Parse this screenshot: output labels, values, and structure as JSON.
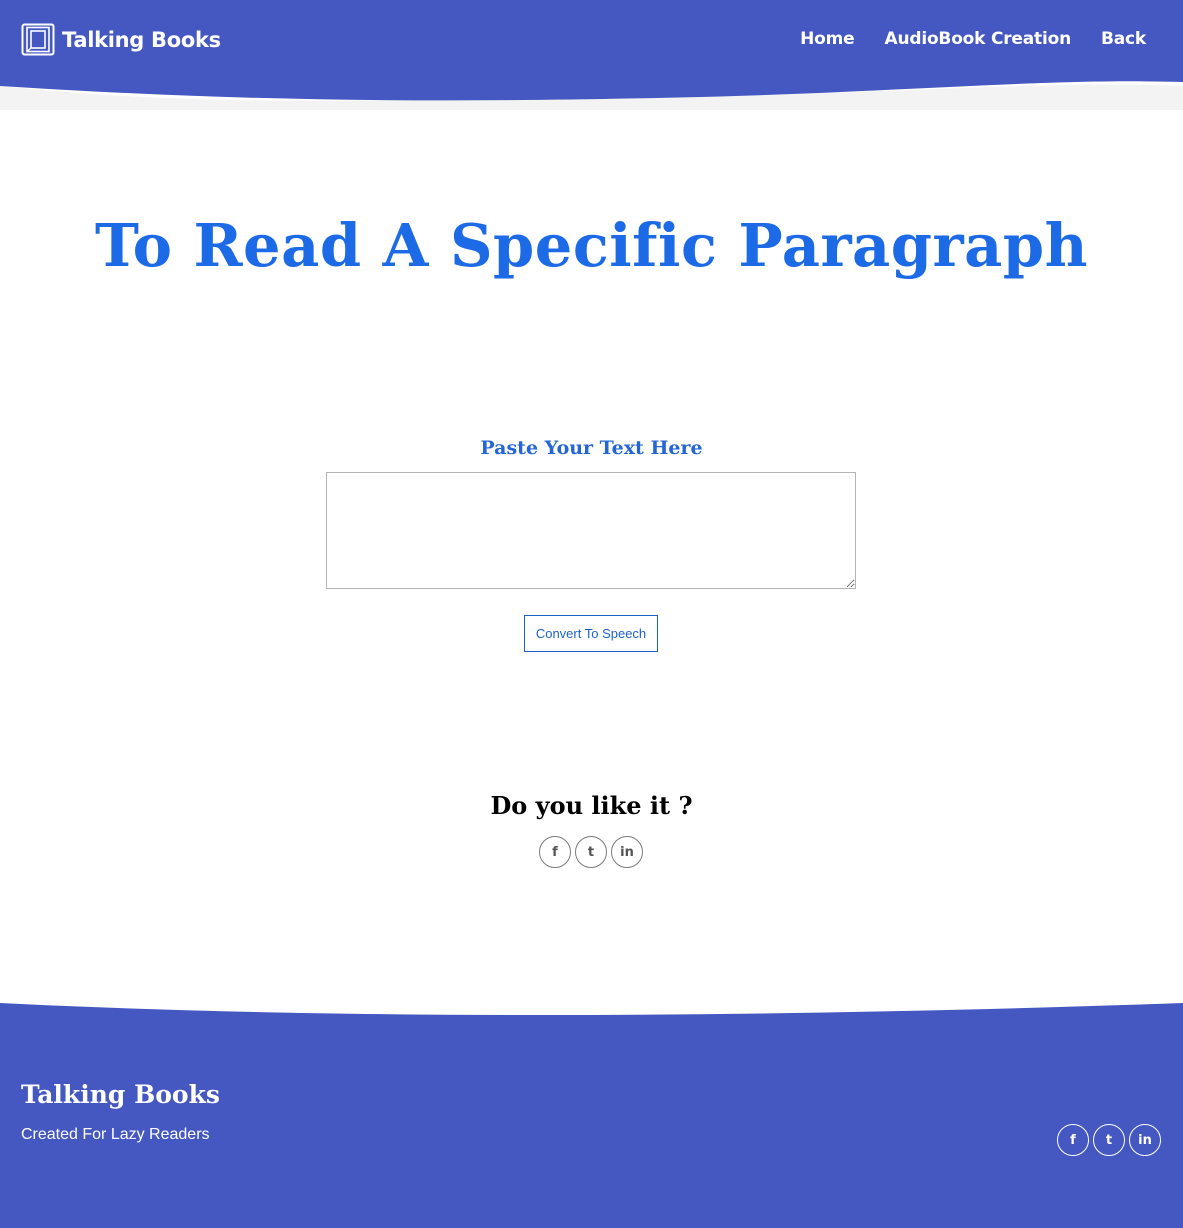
{
  "colors": {
    "primary": "#4558c2",
    "title_blue": "#1d6ae6",
    "wave_shadow": "#f3f3f3",
    "white": "#ffffff"
  },
  "header": {
    "brand": "Talking Books",
    "brand_icon": "book-frame-icon",
    "nav": [
      {
        "label": "Home"
      },
      {
        "label": "AudioBook Creation"
      },
      {
        "label": "Back"
      }
    ]
  },
  "main": {
    "title": "To Read A Specific Paragraph",
    "paste_label": "Paste Your Text Here",
    "textarea_value": "",
    "convert_label": "Convert To Speech",
    "like_heading": "Do you like it ?",
    "social": [
      {
        "icon": "facebook-icon",
        "glyph": "f"
      },
      {
        "icon": "twitter-icon",
        "glyph": "t"
      },
      {
        "icon": "linkedin-icon",
        "glyph": "in"
      }
    ]
  },
  "footer": {
    "title": "Talking Books",
    "subtitle": "Created For Lazy Readers"
  }
}
